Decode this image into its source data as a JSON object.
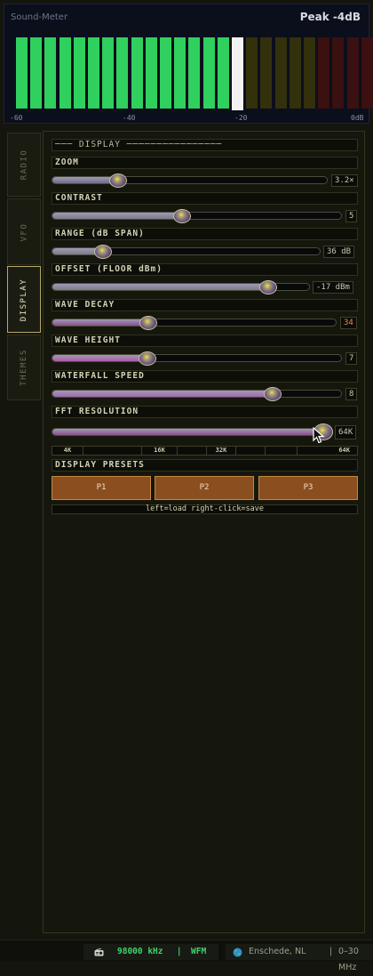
{
  "meter": {
    "title": "Sound-Meter",
    "peak": "Peak -4dB",
    "scale": [
      "-60",
      "-40",
      "-20",
      "0dB"
    ],
    "bar_count": 25,
    "lit_count": 15,
    "peak_index": 15,
    "colors": {
      "lit": "#2fd05e",
      "peak": "#f2f2f2",
      "dim_yellow": "#33300c",
      "dim_red": "#3a1010"
    }
  },
  "tabs": [
    {
      "label": "RADIO",
      "active": false
    },
    {
      "label": "VFO",
      "active": false
    },
    {
      "label": "DISPLAY",
      "active": true
    },
    {
      "label": "THEMES",
      "active": false
    }
  ],
  "display": {
    "section_header": "─── DISPLAY ────────────────",
    "sliders": [
      {
        "label": "ZOOM",
        "value": "3.2×",
        "position": 0.24,
        "color": "#6f6c8a",
        "value_color": "#c9c6ad"
      },
      {
        "label": "CONTRAST",
        "value": "5",
        "position": 0.45,
        "color": "#7d7a8c",
        "value_color": "#c9c6ad"
      },
      {
        "label": "RANGE (dB SPAN)",
        "value": "36 dB",
        "position": 0.19,
        "color": "#7d7a8c",
        "value_color": "#c9c6ad"
      },
      {
        "label": "OFFSET (FLOOR dBm)",
        "value": "-17 dBm",
        "position": 0.84,
        "color": "#7d7a8c",
        "value_color": "#c9c6ad"
      },
      {
        "label": "WAVE DECAY",
        "value": "34",
        "position": 0.34,
        "color": "#8a4f8a",
        "value_color": "#f08a45"
      },
      {
        "label": "WAVE HEIGHT",
        "value": "7",
        "position": 0.33,
        "color": "#b05aa8",
        "value_color": "#c9c6ad"
      },
      {
        "label": "WATERFALL SPEED",
        "value": "8",
        "position": 0.76,
        "color": "#a466b0",
        "value_color": "#c9c6ad"
      },
      {
        "label": "FFT RESOLUTION",
        "value": "64K",
        "position": 0.99,
        "color": "#8b4f8a",
        "value_color": "#c9c6ad"
      }
    ],
    "fft_labels": [
      "4K",
      "",
      "16K",
      "",
      "32K",
      "",
      "",
      "64K"
    ],
    "presets_header": "DISPLAY PRESETS",
    "presets": [
      "P1",
      "P2",
      "P3"
    ],
    "hint": "left=load  right-click=save"
  },
  "status": {
    "frequency": "98000 kHz",
    "mode": "WFM",
    "location": "Enschede, NL",
    "range": "0–30 MHz",
    "colors": {
      "freq": "#3fd36a",
      "text": "#9aa08c"
    }
  }
}
